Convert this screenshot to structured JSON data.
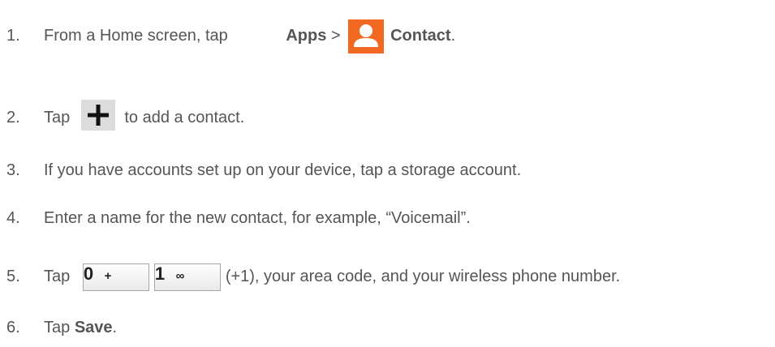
{
  "steps": [
    {
      "number": "1.",
      "text_before": "From a Home screen, tap ",
      "apps_label": "Apps",
      "separator": " > ",
      "contact_label": "Contact",
      "text_after": "."
    },
    {
      "number": "2.",
      "text_before": "Tap ",
      "text_after": " to add a contact."
    },
    {
      "number": "3.",
      "text": "If you have accounts set up on your device, tap a storage account."
    },
    {
      "number": "4.",
      "text": "Enter a name for the new contact, for example, “Voicemail”."
    },
    {
      "number": "5.",
      "text_before": "Tap ",
      "key_zero_main": "0",
      "key_zero_sub": "+",
      "key_one_main": "1",
      "key_one_sub": "∞",
      "text_after": "(+1), your area code, and your wireless phone number."
    },
    {
      "number": "6.",
      "text_before": "Tap ",
      "save_label": "Save",
      "text_after": "."
    }
  ],
  "icons": {
    "apps": "apps-grid-icon",
    "contact": "contact-person-icon",
    "plus": "plus-icon",
    "voicemail": "voicemail-icon"
  },
  "colors": {
    "text": "#555555",
    "contact_icon_bg": "#f26a21",
    "apps_icon": "#9a9a9a",
    "plus_bg": "#dcdcdc"
  }
}
